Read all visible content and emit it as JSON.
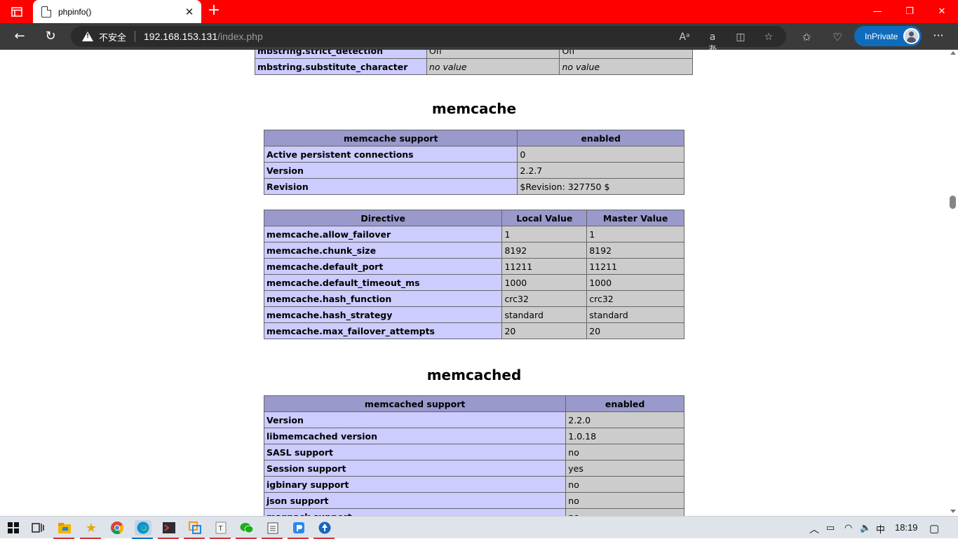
{
  "browser": {
    "tab_title": "phpinfo()",
    "insecure_label": "不安全",
    "url_host": "192.168.153.131",
    "url_path": "/index.php",
    "inprivate_label": "InPrivate"
  },
  "mbstring_rows": [
    {
      "name": "mbstring.strict_detection",
      "local": "Off",
      "master": "Off"
    },
    {
      "name": "mbstring.substitute_character",
      "local": "no value",
      "master": "no value"
    }
  ],
  "memcache": {
    "title": "memcache",
    "info_header": [
      "memcache support",
      "enabled"
    ],
    "info_rows": [
      {
        "name": "Active persistent connections",
        "value": "0"
      },
      {
        "name": "Version",
        "value": "2.2.7"
      },
      {
        "name": "Revision",
        "value": "$Revision: 327750 $"
      }
    ],
    "directive_header": [
      "Directive",
      "Local Value",
      "Master Value"
    ],
    "directives": [
      {
        "name": "memcache.allow_failover",
        "local": "1",
        "master": "1"
      },
      {
        "name": "memcache.chunk_size",
        "local": "8192",
        "master": "8192"
      },
      {
        "name": "memcache.default_port",
        "local": "11211",
        "master": "11211"
      },
      {
        "name": "memcache.default_timeout_ms",
        "local": "1000",
        "master": "1000"
      },
      {
        "name": "memcache.hash_function",
        "local": "crc32",
        "master": "crc32"
      },
      {
        "name": "memcache.hash_strategy",
        "local": "standard",
        "master": "standard"
      },
      {
        "name": "memcache.max_failover_attempts",
        "local": "20",
        "master": "20"
      }
    ]
  },
  "memcached": {
    "title": "memcached",
    "info_header": [
      "memcached support",
      "enabled"
    ],
    "info_rows": [
      {
        "name": "Version",
        "value": "2.2.0"
      },
      {
        "name": "libmemcached version",
        "value": "1.0.18"
      },
      {
        "name": "SASL support",
        "value": "no"
      },
      {
        "name": "Session support",
        "value": "yes"
      },
      {
        "name": "igbinary support",
        "value": "no"
      },
      {
        "name": "json support",
        "value": "no"
      },
      {
        "name": "msgpack support",
        "value": "no"
      }
    ]
  },
  "taskbar": {
    "ime": "中",
    "clock": "18:19"
  }
}
